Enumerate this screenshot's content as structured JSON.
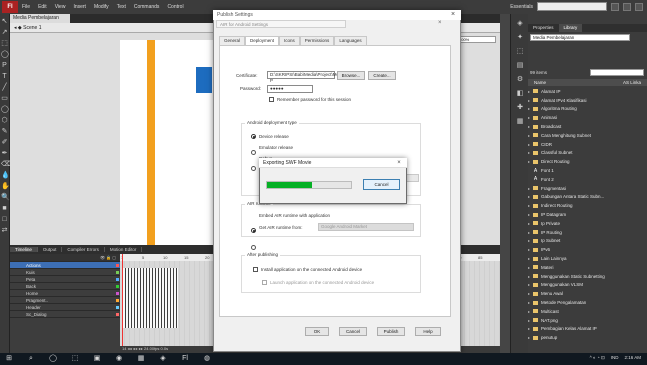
{
  "app": {
    "logo": "Fl",
    "menu": [
      "File",
      "Edit",
      "View",
      "Insert",
      "Modify",
      "Text",
      "Commands",
      "Control"
    ],
    "workspace": "Essentials",
    "search_value": "",
    "window_buttons": [
      "–",
      "□",
      "×"
    ]
  },
  "tools": [
    "↖",
    "↗",
    "⬚",
    "◯",
    "P",
    "T",
    "╱",
    "▭",
    "◯",
    "⬡",
    "✎",
    "✐",
    "✒",
    "⌫",
    "💧",
    "✋",
    "🔍",
    "■",
    "□",
    "⇄"
  ],
  "document": {
    "tab": "Media Pembelajaran",
    "scene": "Scene 1",
    "zoom": "100%"
  },
  "timeline": {
    "tabs": [
      "Timeline",
      "Output",
      "Compiler Errors",
      "Motion Editor"
    ],
    "active_tab": "Timeline",
    "ruler": [
      "1",
      "5",
      "10",
      "15",
      "20",
      "25",
      "30",
      "35",
      "40",
      "45",
      "50",
      "55",
      "60",
      "65",
      "70",
      "75",
      "80",
      "85"
    ],
    "layers": [
      "Actions",
      "Kuis",
      "Peta",
      "Back",
      "Home",
      "Pragment..",
      "Header",
      "Sc_Dialog"
    ],
    "footer": "14  ◂◂ ◂ ▸ ▸▸  24.00fps  0.0s"
  },
  "right_icons": [
    "◈",
    "✦",
    "⬚",
    "▤",
    "⚙",
    "◧",
    "✚",
    "▦"
  ],
  "library": {
    "tabs": [
      "Properties",
      "Library"
    ],
    "active_tab": "Library",
    "document": "Media Pembelajaran",
    "count": "99 items",
    "header_name": "Name",
    "header_linkage": "AS Linka",
    "items": [
      {
        "type": "folder",
        "name": "Alamat IP"
      },
      {
        "type": "folder",
        "name": "Alamat IPv4 Klasifikasi"
      },
      {
        "type": "folder",
        "name": "Algoritma Routing"
      },
      {
        "type": "folder",
        "name": "Animasi"
      },
      {
        "type": "folder",
        "name": "Broadcast"
      },
      {
        "type": "folder",
        "name": "Cara Menghitung Subnet"
      },
      {
        "type": "folder",
        "name": "CIDR"
      },
      {
        "type": "folder",
        "name": "Classful Subnet"
      },
      {
        "type": "folder",
        "name": "Direct Routing"
      },
      {
        "type": "symbol",
        "name": "Font 1"
      },
      {
        "type": "symbol",
        "name": "Font 2"
      },
      {
        "type": "folder",
        "name": "Fragmentasi"
      },
      {
        "type": "folder",
        "name": "Gabungan Antara Static Subn..."
      },
      {
        "type": "folder",
        "name": "Indirect Routing"
      },
      {
        "type": "folder",
        "name": "IP Datagram"
      },
      {
        "type": "folder",
        "name": "Ip Private"
      },
      {
        "type": "folder",
        "name": "IP Routing"
      },
      {
        "type": "folder",
        "name": "Ip Subnet"
      },
      {
        "type": "folder",
        "name": "IPv6"
      },
      {
        "type": "folder",
        "name": "Lain Lainnya"
      },
      {
        "type": "folder",
        "name": "Materi"
      },
      {
        "type": "folder",
        "name": "Menggunakan Static Subnetting"
      },
      {
        "type": "folder",
        "name": "Menggunakan VLSM"
      },
      {
        "type": "folder",
        "name": "Menu Awal"
      },
      {
        "type": "folder",
        "name": "Metode Pengalamatan"
      },
      {
        "type": "folder",
        "name": "Multicast"
      },
      {
        "type": "folder",
        "name": "NAT.png"
      },
      {
        "type": "folder",
        "name": "Pembagian Kelas Alamat IP"
      },
      {
        "type": "folder",
        "name": "penutup"
      }
    ]
  },
  "publish_dialog": {
    "title": "Publish Settings",
    "subtitle": "AIR for Android Settings",
    "close": "×",
    "subclose": "×",
    "tabs": [
      "General",
      "Deployment",
      "Icons",
      "Permissions",
      "Languages"
    ],
    "active_tab": "Deployment",
    "certificate_label": "Certificate:",
    "certificate_value": "D:\\SKRIPSI\\Bab\\Media\\Project\\Media P",
    "browse": "Browse...",
    "create": "Create...",
    "password_label": "Password:",
    "password_value": "●●●●●",
    "remember": "Remember password for this session",
    "deploy_type_title": "Android deployment type",
    "deploy_options": [
      "Device release",
      "Emulator release",
      "Debug"
    ],
    "debug_hint": "",
    "air_runtime_title": "AIR runtime",
    "runtime_options": [
      "Embed AIR runtime with application",
      "Get AIR runtime from:"
    ],
    "runtime_source": "Google Android Market",
    "after_title": "After publishing",
    "after_options": [
      "Install application on the connected Android device",
      "Launch application on the connected Android device"
    ],
    "buttons": [
      "OK",
      "Cancel",
      "Publish",
      "Help"
    ]
  },
  "export_dialog": {
    "title": "Exporting SWF Movie",
    "close": "×",
    "progress": 0.53,
    "cancel": "Cancel"
  },
  "taskbar": {
    "icons": [
      "⊞",
      "⌕",
      "◯",
      "⬚",
      "▣",
      "◉",
      "▦",
      "◈",
      "Fl",
      "◍"
    ],
    "tray_icons": "^  ◐  ◔  ⊡",
    "time": "2:16 AM",
    "lang": "IND"
  }
}
